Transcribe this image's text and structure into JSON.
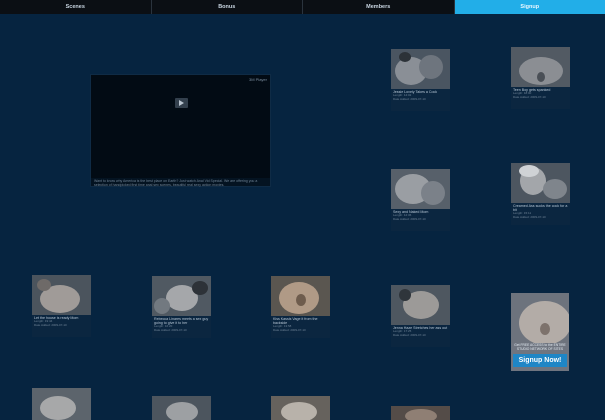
{
  "nav": {
    "tabs": [
      {
        "label": "Scenes"
      },
      {
        "label": "Bonus"
      },
      {
        "label": "Members"
      },
      {
        "label": "Signup"
      }
    ]
  },
  "player": {
    "label": "3M Player",
    "description": "Want to know why America is the best place on Earth? Just watch Anal Vid Special. We are offering you a selection of handpicked first time anal sex scenes, beautiful real sexy action movies."
  },
  "scenes": [
    {
      "title": "Jessie Lovely Takes a Cock",
      "meta1": "Length: 14:02",
      "meta2": "Date Added: 2009-07-10"
    },
    {
      "title": "Teen Boy gets spanked",
      "meta1": "Length: 18:00",
      "meta2": "Date Added: 2009-07-10"
    },
    {
      "title": "Sexy and Naked Mom",
      "meta1": "Length: 12:36",
      "meta2": "Date Added: 2009-07-10"
    },
    {
      "title": "Creamed Ass sucks the cock for a bit",
      "meta1": "Length: 15:11",
      "meta2": "Date Added: 2009-07-10"
    },
    {
      "title": "Let the house is ready Mom",
      "meta1": "Length: 19:44",
      "meta2": "Date Added: 2009-07-10"
    },
    {
      "title": "Rebecca Linares meets a sex guy going to give it to her",
      "meta1": "Length: 16:20",
      "meta2": "Date Added: 2009-07-10"
    },
    {
      "title": "Kiss Kassis Vage it from the backside",
      "meta1": "Length: 13:58",
      "meta2": "Date Added: 2009-07-10"
    },
    {
      "title": "Jenna Haze Stretches her ass out",
      "meta1": "Length: 17:25",
      "meta2": "Date Added: 2009-07-10"
    }
  ],
  "ad": {
    "tagline": "Get FREE ACCESS to the ENTIRE STUDIO NETWORK OF SITES",
    "button_label": "Signup Now!"
  }
}
